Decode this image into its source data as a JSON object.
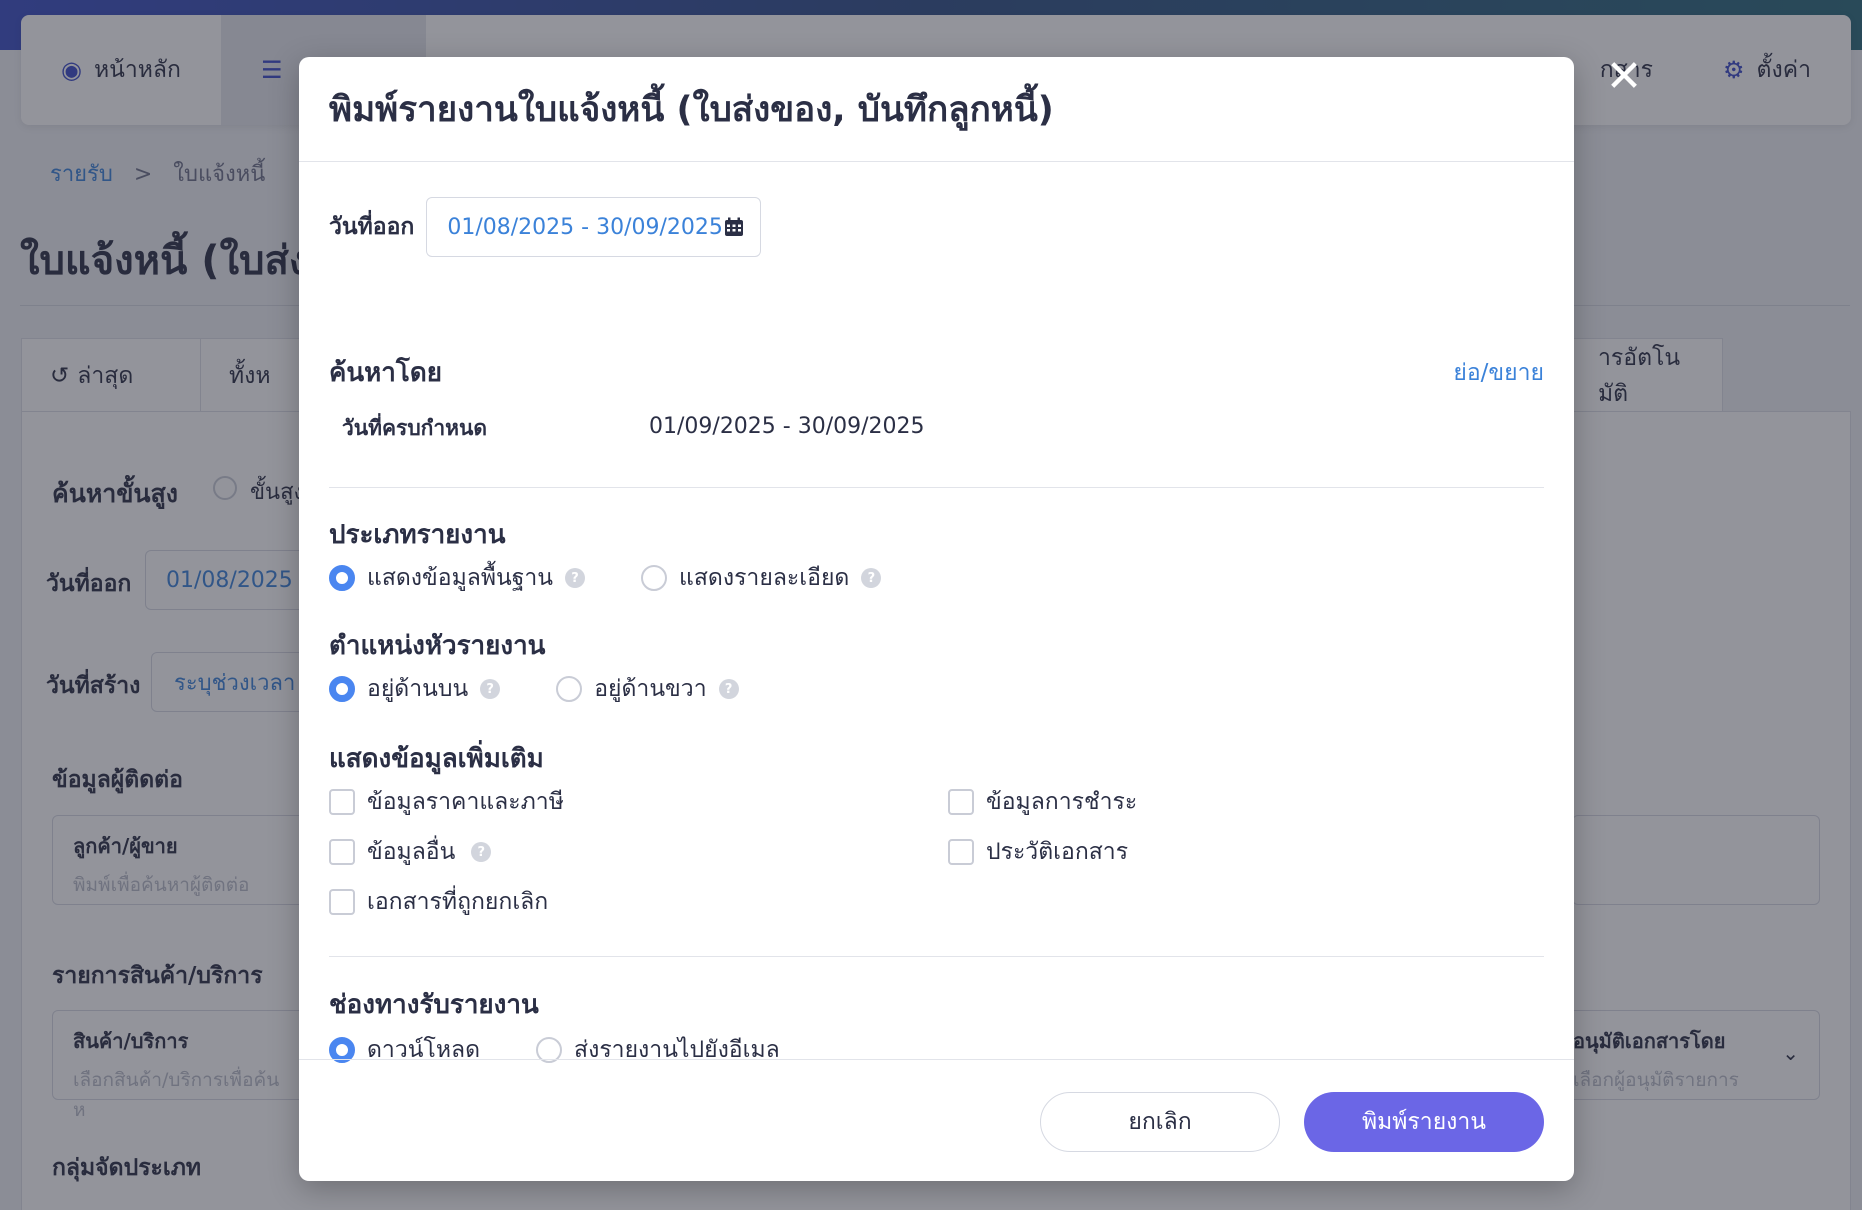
{
  "background": {
    "nav": {
      "home": "หน้าหลัก",
      "partial_right": "กสาร",
      "settings": "ตั้งค่า"
    },
    "breadcrumb": {
      "root": "รายรับ",
      "sep": ">",
      "current": "ใบแจ้งหนี้"
    },
    "page_title": "ใบแจ้งหนี้ (ใบส่งขอ",
    "tabs": {
      "latest": "ล่าสุด",
      "all": "ทั้งห",
      "auto": "ารอัตโนมัติ"
    },
    "advanced_search": "ค้นหาขั้นสูง",
    "advanced_option": "ขั้นสูง",
    "issue_date_label": "วันที่ออก",
    "issue_date_value": "01/08/2025",
    "created_label": "วันที่สร้าง",
    "created_value": "ระบุช่วงเวลา",
    "contact_section": "ข้อมูลผู้ติดต่อ",
    "contact_field": {
      "title": "ลูกค้า/ผู้ขาย",
      "placeholder": "พิมพ์เพื่อค้นหาผู้ติดต่อ"
    },
    "items_section": "รายการสินค้า/บริการ",
    "product_field": {
      "title": "สินค้า/บริการ",
      "placeholder": "เลือกสินค้า/บริการเพื่อค้นห"
    },
    "approver_field": {
      "title": "อนุมัติเอกสารโดย",
      "placeholder": "เลือกผู้อนุมัติรายการ"
    },
    "group_section": "กลุ่มจัดประเภท"
  },
  "modal": {
    "title": "พิมพ์รายงานใบแจ้งหนี้ (ใบส่งของ, บันทึกลูกหนี้)",
    "issue_date_label": "วันที่ออก",
    "issue_date_range": "01/08/2025 - 30/09/2025",
    "search_by_title": "ค้นหาโดย",
    "toggle_label": "ย่อ/ขยาย",
    "due_date_label": "วันที่ครบกำหนด",
    "due_date_range": "01/09/2025 - 30/09/2025",
    "report_type": {
      "title": "ประเภทรายงาน",
      "options": [
        "แสดงข้อมูลพื้นฐาน",
        "แสดงรายละเอียด"
      ],
      "selected": 0
    },
    "header_position": {
      "title": "ตำแหน่งหัวรายงาน",
      "options": [
        "อยู่ด้านบน",
        "อยู่ด้านขวา"
      ],
      "selected": 0
    },
    "extra_info": {
      "title": "แสดงข้อมูลเพิ่มเติม",
      "price_tax": "ข้อมูลราคาและภาษี",
      "payment": "ข้อมูลการชำระ",
      "other": "ข้อมูลอื่น",
      "history": "ประวัติเอกสาร",
      "cancelled": "เอกสารที่ถูกยกเลิก"
    },
    "channel": {
      "title": "ช่องทางรับรายงาน",
      "options": [
        "ดาวน์โหลด",
        "ส่งรายงานไปยังอีเมล"
      ],
      "selected": 0
    },
    "cancel_button": "ยกเลิก",
    "print_button": "พิมพ์รายงาน",
    "help_glyph": "?",
    "close_glyph": "✕"
  },
  "colors": {
    "accent": "#6b66e6",
    "link": "#3b82d9",
    "radio_active": "#4a86f0"
  }
}
